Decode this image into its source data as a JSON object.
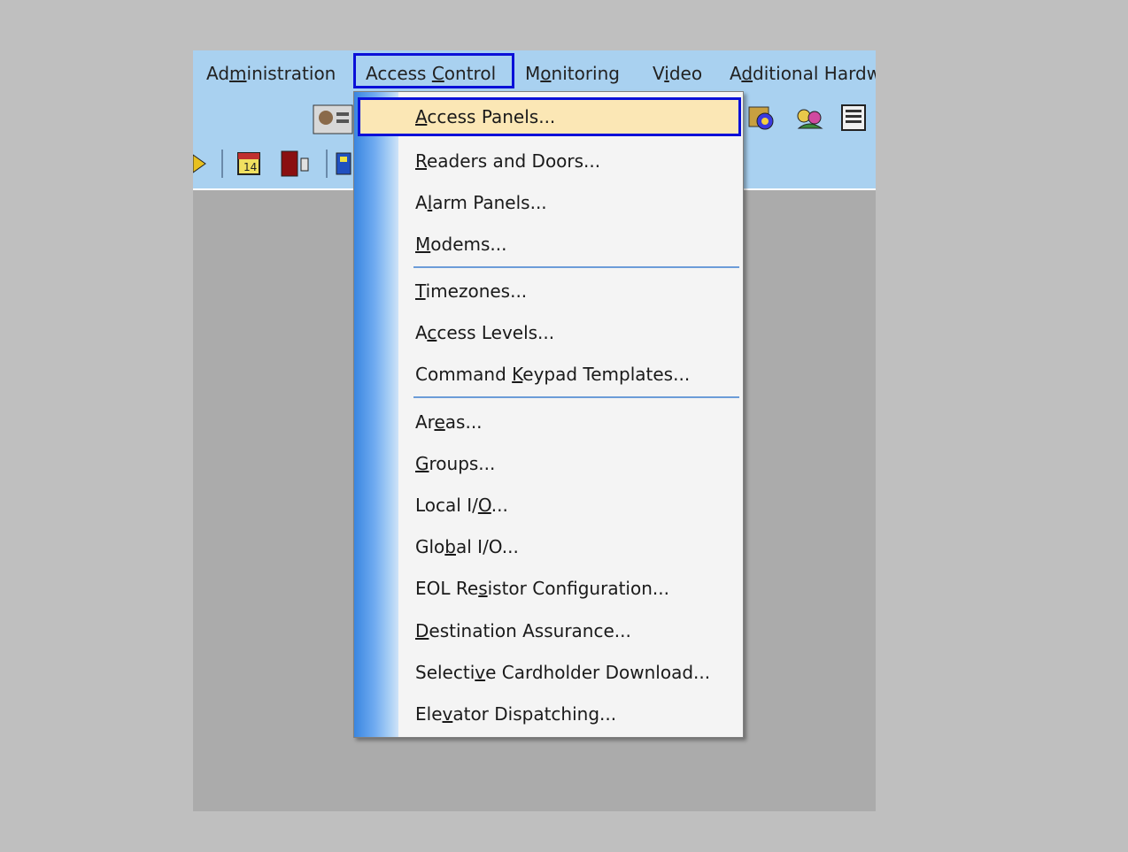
{
  "menubar": {
    "items": [
      {
        "pre": "Ad",
        "key": "m",
        "post": "inistration"
      },
      {
        "pre": "Access ",
        "key": "C",
        "post": "ontrol"
      },
      {
        "pre": "M",
        "key": "o",
        "post": "nitoring"
      },
      {
        "pre": "V",
        "key": "i",
        "post": "deo"
      },
      {
        "pre": "A",
        "key": "d",
        "post": "ditional Hardw"
      }
    ]
  },
  "dropdown": {
    "items": [
      {
        "pre": "",
        "key": "A",
        "post": "ccess Panels..."
      },
      {
        "pre": "",
        "key": "R",
        "post": "eaders and Doors..."
      },
      {
        "pre": "A",
        "key": "l",
        "post": "arm Panels..."
      },
      {
        "pre": "",
        "key": "M",
        "post": "odems..."
      },
      {
        "pre": "",
        "key": "T",
        "post": "imezones..."
      },
      {
        "pre": "A",
        "key": "c",
        "post": "cess Levels..."
      },
      {
        "pre": "Command ",
        "key": "K",
        "post": "eypad Templates..."
      },
      {
        "pre": "Ar",
        "key": "e",
        "post": "as..."
      },
      {
        "pre": "",
        "key": "G",
        "post": "roups..."
      },
      {
        "pre": "Local I/",
        "key": "O",
        "post": "..."
      },
      {
        "pre": "Glo",
        "key": "b",
        "post": "al I/O..."
      },
      {
        "pre": "EOL Re",
        "key": "s",
        "post": "istor Configuration..."
      },
      {
        "pre": "",
        "key": "D",
        "post": "estination Assurance..."
      },
      {
        "pre": "Selecti",
        "key": "v",
        "post": "e Cardholder Download..."
      },
      {
        "pre": "Ele",
        "key": "v",
        "post": "ator Dispatching..."
      }
    ]
  },
  "colors": {
    "menubar_bg": "#a9d1f0",
    "highlight_border": "#0a10d8",
    "selected_bg": "#fbe7b5"
  }
}
